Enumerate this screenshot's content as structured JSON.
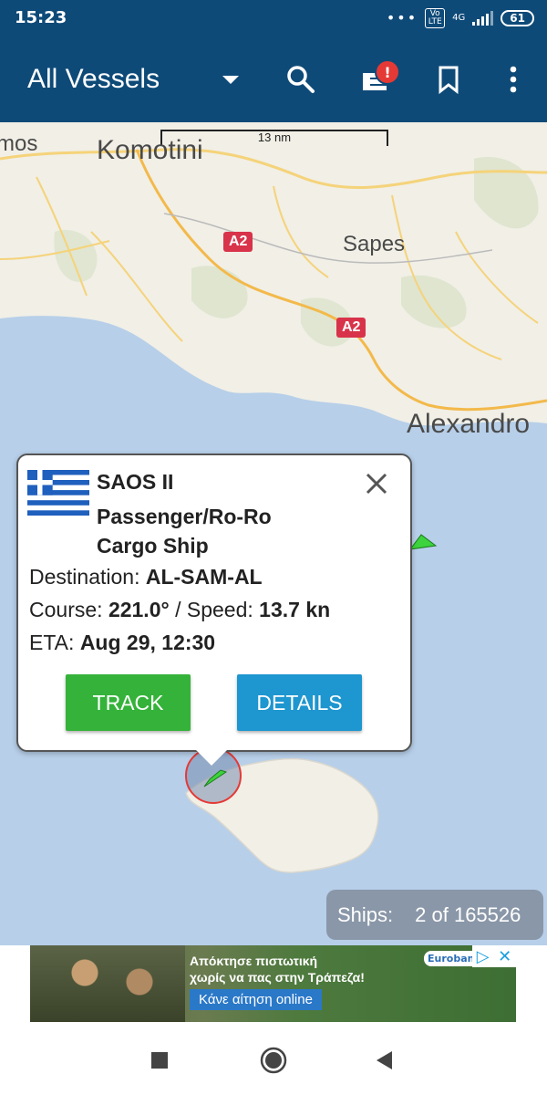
{
  "status": {
    "time": "15:23",
    "volte": "Vo LTE",
    "network": "4G",
    "battery": "61"
  },
  "appbar": {
    "title": "All Vessels",
    "notification_badge": "!"
  },
  "map": {
    "scale": "13 nm",
    "places": {
      "komotini": "Komotini",
      "sapes": "Sapes",
      "alexandro": "Alexandro",
      "partial_left": "mos"
    },
    "roads": {
      "a2_upper": "A2",
      "a2_lower": "A2"
    }
  },
  "popup": {
    "vessel_name": "SAOS II",
    "vessel_type": "Passenger/Ro-Ro Cargo Ship",
    "destination_label": "Destination:",
    "destination": "AL-SAM-AL",
    "course_label": "Course:",
    "course": "221.0°",
    "sep": "/",
    "speed_label": "Speed:",
    "speed": "13.7 kn",
    "eta_label": "ETA:",
    "eta": "Aug 29, 12:30",
    "track_label": "TRACK",
    "details_label": "DETAILS"
  },
  "ships": {
    "label": "Ships:",
    "count": "2 of 165526"
  },
  "ad": {
    "line1": "Απόκτησε πιστωτική",
    "line2": "χωρίς να πας στην Τράπεζα!",
    "cta": "Κάνε αίτηση online",
    "brand": "Eurobank"
  },
  "colors": {
    "header": "#0e4a78",
    "track": "#35b23a",
    "details": "#1e96cf",
    "sea": "#b7cfe9",
    "land": "#f1efe6"
  }
}
